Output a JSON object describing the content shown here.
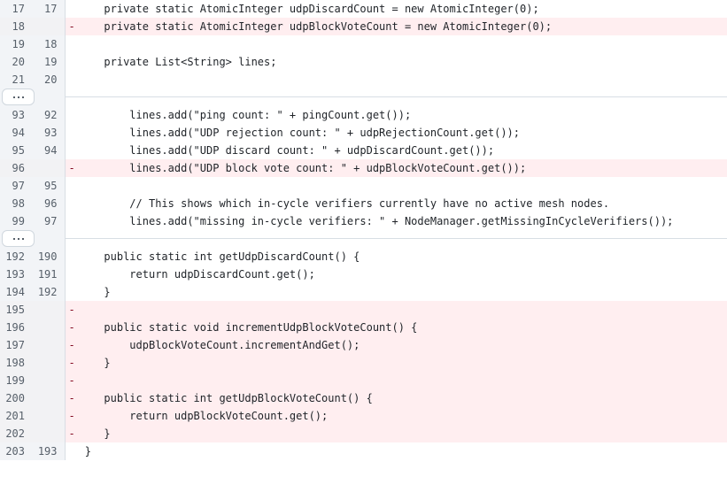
{
  "view": {
    "type": "unified-diff",
    "language": "java",
    "colors": {
      "deleted_bg": "#ffeef0",
      "gutter_bg": "#f2f4f7",
      "gutter_border": "#d8dee4",
      "text": "#1f2328",
      "line_number_text": "#57606a",
      "marker_text": "#82071e",
      "context_bg": "#ffffff"
    },
    "expander_label": "...",
    "expander_dots": 3
  },
  "rows": [
    {
      "kind": "ctx",
      "old": "17",
      "new": "17",
      "marker": " ",
      "code": "    private static AtomicInteger udpDiscardCount = new AtomicInteger(0);"
    },
    {
      "kind": "del",
      "old": "18",
      "new": "",
      "marker": "-",
      "code": "    private static AtomicInteger udpBlockVoteCount = new AtomicInteger(0);"
    },
    {
      "kind": "ctx",
      "old": "19",
      "new": "18",
      "marker": " ",
      "code": ""
    },
    {
      "kind": "ctx",
      "old": "20",
      "new": "19",
      "marker": " ",
      "code": "    private List<String> lines;"
    },
    {
      "kind": "ctx",
      "old": "21",
      "new": "20",
      "marker": " ",
      "code": ""
    },
    {
      "kind": "expander"
    },
    {
      "kind": "ctx",
      "old": "93",
      "new": "92",
      "marker": " ",
      "code": "        lines.add(\"ping count: \" + pingCount.get());"
    },
    {
      "kind": "ctx",
      "old": "94",
      "new": "93",
      "marker": " ",
      "code": "        lines.add(\"UDP rejection count: \" + udpRejectionCount.get());"
    },
    {
      "kind": "ctx",
      "old": "95",
      "new": "94",
      "marker": " ",
      "code": "        lines.add(\"UDP discard count: \" + udpDiscardCount.get());"
    },
    {
      "kind": "del",
      "old": "96",
      "new": "",
      "marker": "-",
      "code": "        lines.add(\"UDP block vote count: \" + udpBlockVoteCount.get());"
    },
    {
      "kind": "ctx",
      "old": "97",
      "new": "95",
      "marker": " ",
      "code": ""
    },
    {
      "kind": "ctx",
      "old": "98",
      "new": "96",
      "marker": " ",
      "code": "        // This shows which in-cycle verifiers currently have no active mesh nodes."
    },
    {
      "kind": "ctx",
      "old": "99",
      "new": "97",
      "marker": " ",
      "code": "        lines.add(\"missing in-cycle verifiers: \" + NodeManager.getMissingInCycleVerifiers());"
    },
    {
      "kind": "expander"
    },
    {
      "kind": "ctx",
      "old": "192",
      "new": "190",
      "marker": " ",
      "code": "    public static int getUdpDiscardCount() {"
    },
    {
      "kind": "ctx",
      "old": "193",
      "new": "191",
      "marker": " ",
      "code": "        return udpDiscardCount.get();"
    },
    {
      "kind": "ctx",
      "old": "194",
      "new": "192",
      "marker": " ",
      "code": "    }"
    },
    {
      "kind": "del",
      "old": "195",
      "new": "",
      "marker": "-",
      "code": ""
    },
    {
      "kind": "del",
      "old": "196",
      "new": "",
      "marker": "-",
      "code": "    public static void incrementUdpBlockVoteCount() {"
    },
    {
      "kind": "del",
      "old": "197",
      "new": "",
      "marker": "-",
      "code": "        udpBlockVoteCount.incrementAndGet();"
    },
    {
      "kind": "del",
      "old": "198",
      "new": "",
      "marker": "-",
      "code": "    }"
    },
    {
      "kind": "del",
      "old": "199",
      "new": "",
      "marker": "-",
      "code": ""
    },
    {
      "kind": "del",
      "old": "200",
      "new": "",
      "marker": "-",
      "code": "    public static int getUdpBlockVoteCount() {"
    },
    {
      "kind": "del",
      "old": "201",
      "new": "",
      "marker": "-",
      "code": "        return udpBlockVoteCount.get();"
    },
    {
      "kind": "del",
      "old": "202",
      "new": "",
      "marker": "-",
      "code": "    }"
    },
    {
      "kind": "ctx",
      "old": "203",
      "new": "193",
      "marker": " ",
      "code": " }"
    }
  ]
}
